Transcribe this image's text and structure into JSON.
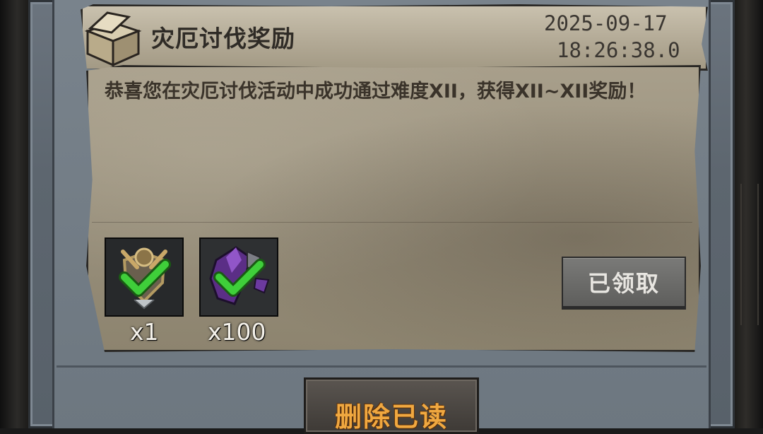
{
  "mail": {
    "title": "灾厄讨伐奖励",
    "date": "2025-09-17",
    "time": "18:26:38.0",
    "message": "恭喜您在灾厄讨伐活动中成功通过难度XII，获得XII~XII奖励！"
  },
  "rewards": [
    {
      "icon": "emblem-badge-icon",
      "quantity": "x1",
      "claimed": true
    },
    {
      "icon": "purple-crystal-icon",
      "quantity": "x100",
      "claimed": true
    }
  ],
  "buttons": {
    "claimed_label": "已领取",
    "delete_read_label": "删除已读"
  },
  "colors": {
    "delete_text": "#f0a840",
    "check": "#3fcf3a",
    "paper": "#a89f8b"
  }
}
